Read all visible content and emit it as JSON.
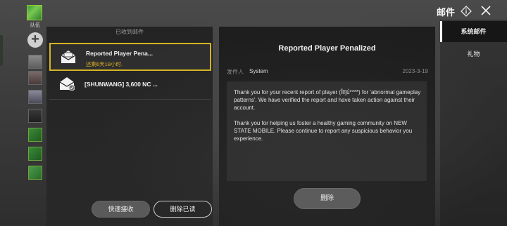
{
  "header": {
    "title": "邮件"
  },
  "party": {
    "label": "队伍",
    "add_symbol": "+"
  },
  "tabs": [
    {
      "label": "系统邮件",
      "active": true
    },
    {
      "label": "礼物",
      "active": false
    }
  ],
  "mail_list": {
    "title": "已收到邮件",
    "items": [
      {
        "subject": "Reported Player Pena...",
        "expire": "还剩6天18小时.",
        "selected": true
      },
      {
        "subject": "[SHUNWANG] 3,600 NC ...",
        "expire": "",
        "selected": false
      }
    ],
    "quick_receive_label": "快速接收",
    "delete_read_label": "删除已读"
  },
  "detail": {
    "title": "Reported Player Penalized",
    "sender_label": "发件人",
    "sender": "System",
    "date": "2023-3-19",
    "body_paragraphs": [
      "Thank you for your recent report of player (Ĩlǐ]ǘ****) for 'abnormal gameplay patterns'. We have verified the report and have taken action against their account.",
      "Thank you for helping us foster a healthy gaming community on NEW STATE MOBILE. Please continue to report any suspicious behavior you experience."
    ],
    "delete_label": "删除"
  },
  "colors": {
    "accent_gold": "#d6b424",
    "expire_text": "#e0b52a"
  }
}
